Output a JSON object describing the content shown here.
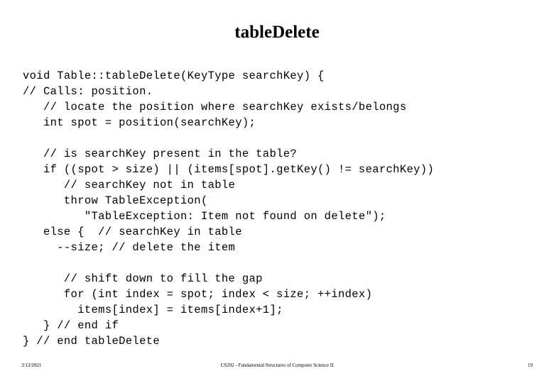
{
  "slide": {
    "title": "tableDelete",
    "code_lines": [
      "void Table::tableDelete(KeyType searchKey) {",
      "// Calls: position.",
      "   // locate the position where searchKey exists/belongs",
      "   int spot = position(searchKey);",
      "",
      "   // is searchKey present in the table?",
      "   if ((spot > size) || (items[spot].getKey() != searchKey))",
      "      // searchKey not in table",
      "      throw TableException(",
      "         \"TableException: Item not found on delete\");",
      "   else {  // searchKey in table",
      "     --size; // delete the item",
      "",
      "      // shift down to fill the gap",
      "      for (int index = spot; index < size; ++index)",
      "        items[index] = items[index+1];",
      "   } // end if",
      "} // end tableDelete"
    ],
    "footer": {
      "date": "3/12/2021",
      "center": "CS202 - Fundamental Structures of Computer Science II",
      "page_number": "19"
    }
  }
}
